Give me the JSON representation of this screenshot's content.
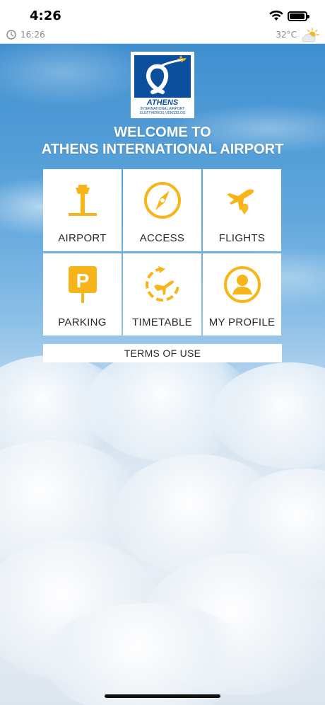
{
  "status_bar": {
    "time": "4:26"
  },
  "info_bar": {
    "time": "16:26",
    "temperature": "32°C",
    "weather_icon": "partly-sunny-icon",
    "clock_icon": "clock-icon"
  },
  "logo": {
    "name": "ATHENS",
    "line1": "INTERNATIONAL AIRPORT",
    "line2": "ELEFTHERIOS VENIZELOS"
  },
  "welcome": {
    "line1": "WELCOME TO",
    "line2": "ATHENS INTERNATIONAL AIRPORT"
  },
  "menu": [
    {
      "label": "AIRPORT",
      "icon": "control-tower-icon"
    },
    {
      "label": "ACCESS",
      "icon": "compass-icon"
    },
    {
      "label": "FLIGHTS",
      "icon": "plane-location-icon"
    },
    {
      "label": "PARKING",
      "icon": "parking-sign-icon"
    },
    {
      "label": "TIMETABLE",
      "icon": "timetable-plane-icon"
    },
    {
      "label": "MY PROFILE",
      "icon": "user-profile-icon"
    }
  ],
  "terms_label": "TERMS OF USE",
  "colors": {
    "accent": "#F7B519",
    "brand_blue": "#0C4F9C",
    "sky": "#3F8FD0"
  }
}
